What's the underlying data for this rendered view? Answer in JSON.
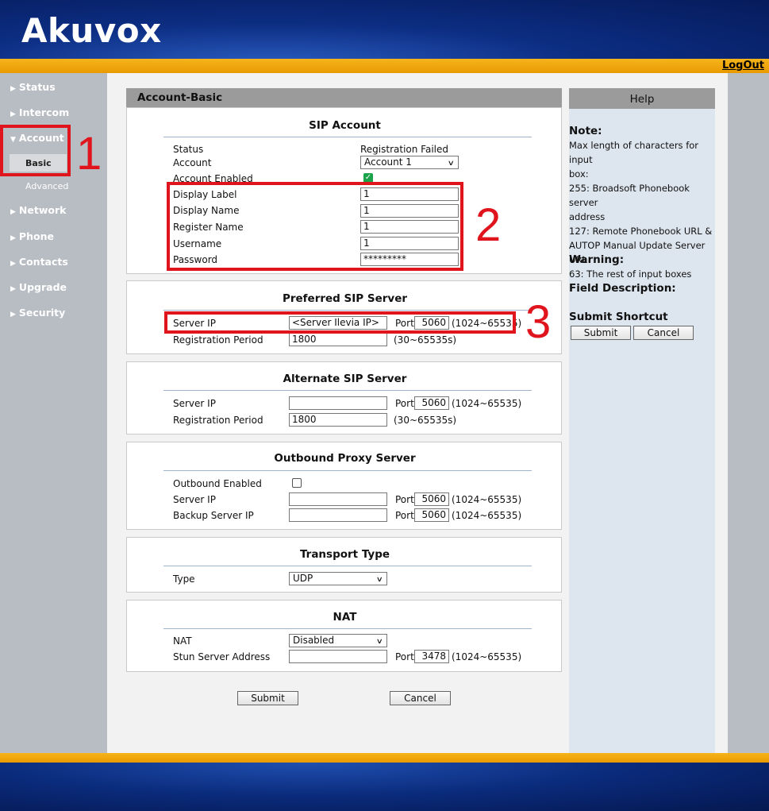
{
  "header": {
    "logo": "Akuvox",
    "logout": "LogOut"
  },
  "sidebar": {
    "items": [
      {
        "label": "Status"
      },
      {
        "label": "Intercom"
      },
      {
        "label": "Account"
      },
      {
        "label": "Network"
      },
      {
        "label": "Phone"
      },
      {
        "label": "Contacts"
      },
      {
        "label": "Upgrade"
      },
      {
        "label": "Security"
      }
    ],
    "sub": {
      "basic": "Basic",
      "advanced": "Advanced"
    }
  },
  "annotations": {
    "n1": "1",
    "n2": "2",
    "n3": "3"
  },
  "page_title": "Account-Basic",
  "sip_account": {
    "title": "SIP Account",
    "status_label": "Status",
    "status_value": "Registration Failed",
    "account_label": "Account",
    "account_value": "Account 1",
    "enabled_label": "Account Enabled",
    "display_label_label": "Display Label",
    "display_label_value": "1",
    "display_name_label": "Display Name",
    "display_name_value": "1",
    "register_name_label": "Register Name",
    "register_name_value": "1",
    "username_label": "Username",
    "username_value": "1",
    "password_label": "Password",
    "password_value": "*********"
  },
  "preferred": {
    "title": "Preferred SIP Server",
    "server_ip_label": "Server IP",
    "server_ip_value": "<Server Ilevia IP>",
    "port_label": "Port",
    "port_value": "5060",
    "port_range": "(1024~65535)",
    "reg_label": "Registration Period",
    "reg_value": "1800",
    "reg_range": "(30~65535s)"
  },
  "alternate": {
    "title": "Alternate SIP Server",
    "server_ip_label": "Server IP",
    "server_ip_value": "",
    "port_label": "Port",
    "port_value": "5060",
    "port_range": "(1024~65535)",
    "reg_label": "Registration Period",
    "reg_value": "1800",
    "reg_range": "(30~65535s)"
  },
  "outbound": {
    "title": "Outbound Proxy Server",
    "enabled_label": "Outbound Enabled",
    "server_ip_label": "Server IP",
    "server_ip_value": "",
    "port_label": "Port",
    "port_value": "5060",
    "port_range": "(1024~65535)",
    "backup_label": "Backup Server IP",
    "backup_value": "",
    "backup_port_label": "Port",
    "backup_port_value": "5060",
    "backup_port_range": "(1024~65535)"
  },
  "transport": {
    "title": "Transport Type",
    "type_label": "Type",
    "type_value": "UDP"
  },
  "nat": {
    "title": "NAT",
    "nat_label": "NAT",
    "nat_value": "Disabled",
    "stun_label": "Stun Server Address",
    "stun_value": "",
    "port_label": "Port",
    "port_value": "3478",
    "port_range": "(1024~65535)"
  },
  "buttons": {
    "submit": "Submit",
    "cancel": "Cancel"
  },
  "help": {
    "title": "Help",
    "note_heading": "Note:",
    "note_lines": [
      "Max length of characters for input",
      "box:",
      "255: Broadsoft Phonebook server",
      "address",
      "127: Remote Phonebook URL &",
      "AUTOP Manual Update Server URL",
      "63: The rest of input boxes"
    ],
    "warning_heading": "Warning:",
    "field_heading": "Field Description:",
    "shortcut_heading": "Submit Shortcut",
    "submit": "Submit",
    "cancel": "Cancel"
  }
}
